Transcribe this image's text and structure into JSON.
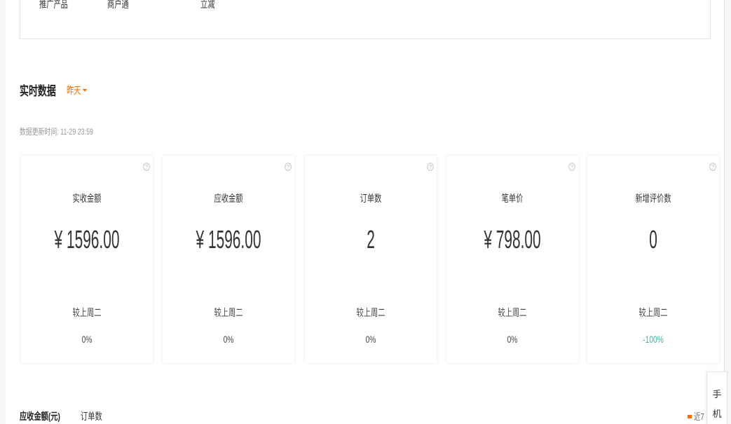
{
  "promo_table": {
    "headers": [
      "推广产品",
      "商户通",
      "立减"
    ]
  },
  "realtime": {
    "title": "实时数据",
    "period": "昨天",
    "period_icon": "caret-down-icon",
    "updated_at": "数据更新时间: 11-29 23:59",
    "help_icon": "question-circle-icon",
    "metrics": [
      {
        "label": "实收金额",
        "value": "¥ 1596.00",
        "compare_label": "较上周二",
        "change": "0%",
        "change_color": "#444444"
      },
      {
        "label": "应收金额",
        "value": "¥ 1596.00",
        "compare_label": "较上周二",
        "change": "0%",
        "change_color": "#444444"
      },
      {
        "label": "订单数",
        "value": "2",
        "compare_label": "较上周二",
        "change": "0%",
        "change_color": "#444444"
      },
      {
        "label": "笔单价",
        "value": "¥ 798.00",
        "compare_label": "较上周二",
        "change": "0%",
        "change_color": "#444444"
      },
      {
        "label": "新增评价数",
        "value": "0",
        "compare_label": "较上周二",
        "change": "-100%",
        "change_color": "#3bb4a3"
      }
    ]
  },
  "trend_chart": {
    "tabs": [
      {
        "label": "应收金额(元)",
        "active": true
      },
      {
        "label": "订单数",
        "active": false
      }
    ],
    "legend": {
      "label": "近7",
      "color": "#ff6a00"
    }
  },
  "side_float": {
    "label_chars": [
      "手",
      "机"
    ]
  },
  "colors": {
    "accent": "#ff6a00",
    "text": "#333333",
    "muted": "#999999",
    "decrease": "#3bb4a3"
  }
}
